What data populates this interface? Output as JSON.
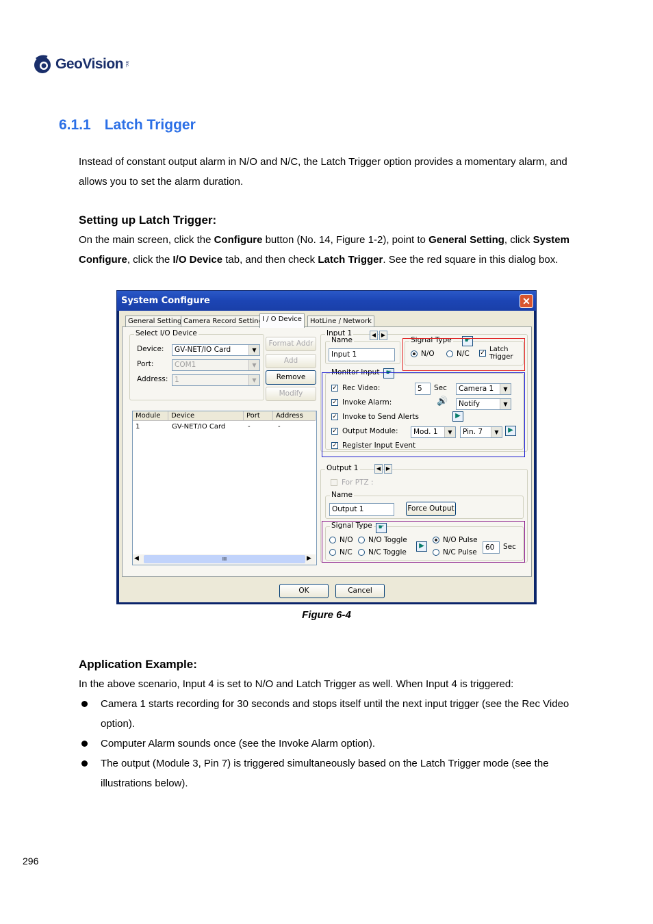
{
  "logo": {
    "text": "GeoVision",
    "tm": "Inc."
  },
  "heading": {
    "number": "6.1.1",
    "title": "Latch Trigger"
  },
  "intro": "Instead of constant output alarm in N/O and N/C, the Latch Trigger option provides a momentary alarm, and allows you to set the alarm duration.",
  "setup": {
    "heading": "Setting up Latch Trigger:",
    "t1": "On the main screen, click the ",
    "b1": "Configure",
    "t2": " button (No. 14, Figure 1-2), point to ",
    "b2": "General Setting",
    "t3": ", click ",
    "b3": "System Configure",
    "t4": ", click the ",
    "b4": "I/O Device",
    "t5": " tab, and then check ",
    "b5": "Latch Trigger",
    "t6": ". See the red square in this dialog box."
  },
  "dialog": {
    "title": "System Configure",
    "close": "✕",
    "tabs": [
      "General Setting",
      "Camera Record Setting",
      "I / O Device",
      "HotLine / Network"
    ],
    "select_group": "Select I/O Device",
    "device_label": "Device:",
    "device_value": "GV-NET/IO Card",
    "port_label": "Port:",
    "port_value": "COM1",
    "address_label": "Address:",
    "address_value": "1",
    "btn_format": "Format Addr",
    "btn_add": "Add",
    "btn_remove": "Remove",
    "btn_modify": "Modify",
    "list_headers": [
      "Module",
      "Device",
      "Port",
      "Address"
    ],
    "list_row": [
      "1",
      "GV-NET/IO Card",
      "-",
      "-"
    ],
    "scroll_grip": "III",
    "input_group": "Input 1",
    "name_label": "Name",
    "input_name": "Input 1",
    "signal_type": "Signal Type",
    "no": "N/O",
    "nc": "N/C",
    "latch_line1": "Latch",
    "latch_line2": "Trigger",
    "monitor_input": "Monitor Input",
    "rec_video": "Rec Video:",
    "rec_sec_value": "5",
    "sec": "Sec",
    "camera_value": "Camera 1",
    "invoke_alarm": "Invoke Alarm:",
    "notify_value": "Notify",
    "invoke_alerts": "Invoke to Send Alerts",
    "output_module": "Output Module:",
    "mod_value": "Mod. 1",
    "pin_value": "Pin. 7",
    "register_input": "Register Input Event",
    "output_group": "Output 1",
    "for_ptz": "For PTZ :",
    "output_name": "Output 1",
    "force_output": "Force Output",
    "out_signal_type": "Signal Type",
    "out_no": "N/O",
    "out_no_toggle": "N/O Toggle",
    "out_nc": "N/C",
    "out_nc_toggle": "N/C Toggle",
    "out_no_pulse": "N/O Pulse",
    "out_nc_pulse": "N/C Pulse",
    "pulse_value": "60",
    "pulse_sec": "Sec",
    "ok": "OK",
    "cancel": "Cancel",
    "highlight_colors": {
      "latch": "#e02020",
      "monitor": "#1a1ad0",
      "output_signal": "#8a1a8a"
    }
  },
  "caption": "Figure 6-4",
  "app_example": {
    "heading": "Application Example:",
    "intro": "In the above scenario, Input 4 is set to N/O and Latch Trigger as well. When Input 4 is triggered:",
    "bullets": [
      "Camera 1 starts recording for 30 seconds and stops itself until the next input trigger (see the Rec Video option).",
      "Computer Alarm sounds once (see the Invoke Alarm option).",
      "The output (Module 3, Pin 7) is triggered simultaneously based on the Latch Trigger mode (see the illustrations below)."
    ]
  },
  "page_number": "296"
}
